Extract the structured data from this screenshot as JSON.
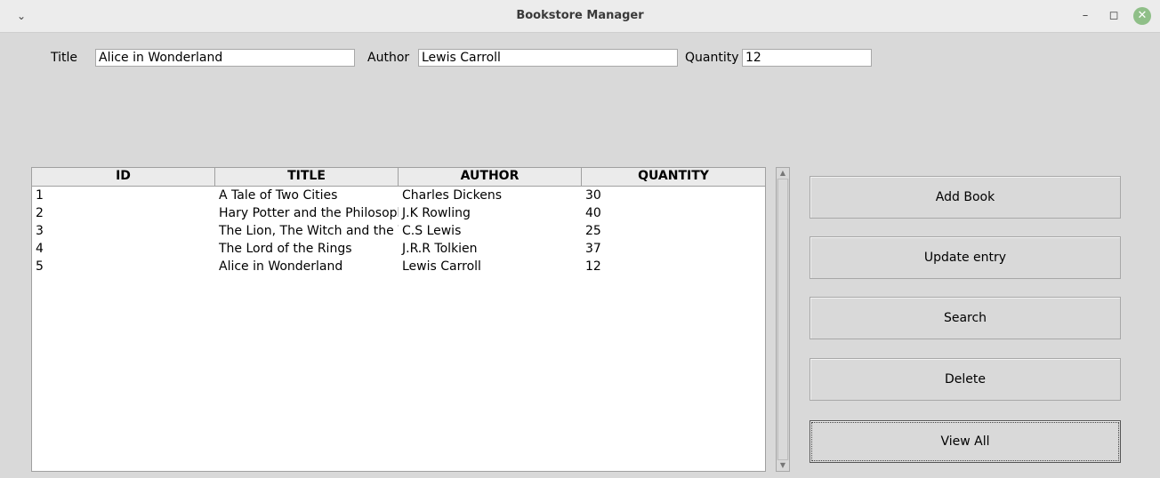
{
  "window": {
    "title": "Bookstore Manager",
    "menu_icon": "chevron-down-icon",
    "minimize_icon": "minimize-icon",
    "maximize_icon": "maximize-icon",
    "close_icon": "close-icon",
    "close_color": "#8fbf88"
  },
  "form": {
    "title_label": "Title",
    "title_value": "Alice in Wonderland",
    "author_label": "Author",
    "author_value": "Lewis Carroll",
    "quantity_label": "Quantity",
    "quantity_value": "12"
  },
  "table": {
    "columns": [
      "ID",
      "TITLE",
      "AUTHOR",
      "QUANTITY"
    ],
    "rows": [
      [
        "1",
        "A Tale of Two Cities",
        "Charles Dickens",
        "30"
      ],
      [
        "2",
        "Hary Potter and the Philosopher's Stone",
        "J.K Rowling",
        "40"
      ],
      [
        "3",
        "The Lion, The Witch and the Wardrobe",
        "C.S Lewis",
        "25"
      ],
      [
        "4",
        "The Lord of the Rings",
        "J.R.R Tolkien",
        "37"
      ],
      [
        "5",
        "Alice in Wonderland",
        "Lewis Carroll",
        "12"
      ]
    ]
  },
  "buttons": {
    "add": "Add Book",
    "update": "Update entry",
    "search": "Search",
    "delete": "Delete",
    "view_all": "View All"
  }
}
